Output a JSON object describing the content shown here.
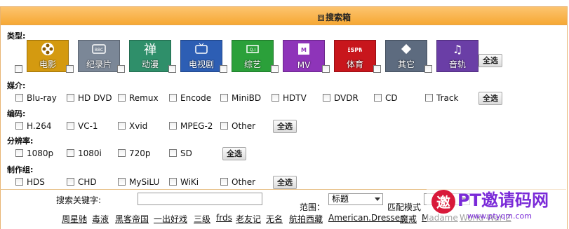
{
  "header": {
    "toggle": "⊟",
    "title": "搜索箱"
  },
  "type_section": {
    "label": "类型:",
    "select_all": "全选",
    "categories": [
      {
        "label": "电影",
        "color": "#d49a10",
        "icon": "film-reel-icon"
      },
      {
        "label": "纪录片",
        "color": "#7b8797",
        "icon": "bbc-icon"
      },
      {
        "label": "动漫",
        "color": "#2f8f6a",
        "icon": "zen-character-icon"
      },
      {
        "label": "电视剧",
        "color": "#2d5eb4",
        "icon": "tv-icon"
      },
      {
        "label": "综艺",
        "color": "#2ba03a",
        "icon": "qi-box-icon"
      },
      {
        "label": "MV",
        "color": "#8e34b9",
        "icon": "mtv-icon"
      },
      {
        "label": "体育",
        "color": "#c8161c",
        "icon": "espn-icon"
      },
      {
        "label": "其它",
        "color": "#5d6b7f",
        "icon": "diamond-icon"
      },
      {
        "label": "音轨",
        "color": "#6a3ea6",
        "icon": "music-notes-icon"
      }
    ]
  },
  "medium": {
    "label": "媒介:",
    "options": [
      "Blu-ray",
      "HD DVD",
      "Remux",
      "Encode",
      "MiniBD",
      "HDTV",
      "DVDR",
      "CD",
      "Track"
    ],
    "select_all": "全选"
  },
  "codec": {
    "label": "编码:",
    "options": [
      "H.264",
      "VC-1",
      "Xvid",
      "MPEG-2",
      "Other"
    ],
    "select_all": "全选"
  },
  "resolution": {
    "label": "分辨率:",
    "options": [
      "1080p",
      "1080i",
      "720p",
      "SD"
    ],
    "select_all": "全选"
  },
  "team": {
    "label": "制作组:",
    "options": [
      "HDS",
      "CHD",
      "MySiLU",
      "WiKi",
      "Other"
    ],
    "select_all": "全选"
  },
  "search": {
    "keyword_label": "搜索关键字:",
    "keyword_value": "",
    "scope_label": "范围：",
    "scope_value": "标题",
    "match_label": "匹配模式"
  },
  "hot_keywords": [
    "周星驰",
    "毒液",
    "黑客帝国",
    "一出好戏",
    "三级",
    "frds",
    "老友记",
    "无名",
    "航拍西藏",
    "American.Dresser",
    "魔戒",
    "Madame",
    "World War Z"
  ],
  "watermark": {
    "title": "PT邀请码网",
    "url": "www.ptyqm.com",
    "brand_color": "#7a2ad8",
    "accent": "#d8193a"
  }
}
